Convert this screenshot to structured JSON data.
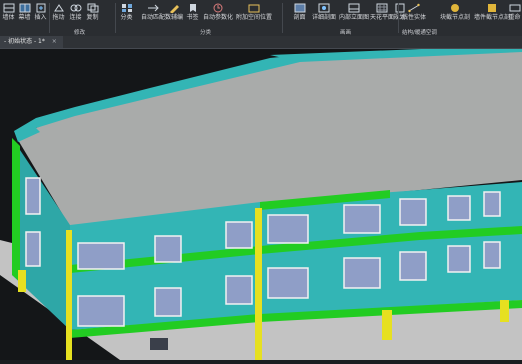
{
  "ribbon": {
    "tools": [
      {
        "id": "t1",
        "label": "墙体",
        "icon": "wall-icon"
      },
      {
        "id": "t2",
        "label": "幕墙",
        "icon": "curtain-wall-icon"
      },
      {
        "id": "t3",
        "label": "插入",
        "icon": "insert-icon"
      },
      {
        "id": "t4",
        "label": "拖动",
        "icon": "drag-icon"
      },
      {
        "id": "t5",
        "label": "连接",
        "icon": "connect-icon"
      },
      {
        "id": "t6",
        "label": "复制",
        "icon": "copy-icon"
      },
      {
        "id": "t7",
        "label": "分类",
        "icon": "classify-icon"
      },
      {
        "id": "t8",
        "label": "自动匹配",
        "icon": "auto-match-icon"
      },
      {
        "id": "t9",
        "label": "数辅编",
        "icon": "assist-edit-icon"
      },
      {
        "id": "t10",
        "label": "书签",
        "icon": "bookmark-icon"
      },
      {
        "id": "t11",
        "label": "自动参数化",
        "icon": "auto-param-icon"
      },
      {
        "id": "t12",
        "label": "附加空间位置",
        "icon": "space-position-icon"
      },
      {
        "id": "t13",
        "label": "剖面",
        "icon": "section-icon"
      },
      {
        "id": "t14",
        "label": "详细剖面",
        "icon": "detail-section-icon"
      },
      {
        "id": "t15",
        "label": "内部立面图",
        "icon": "interior-elevation-icon"
      },
      {
        "id": "t16",
        "label": "天花平面",
        "icon": "ceiling-plan-icon"
      },
      {
        "id": "t17",
        "label": "规划",
        "icon": "plan-icon"
      },
      {
        "id": "t18",
        "label": "线性实体",
        "icon": "linear-entity-icon"
      },
      {
        "id": "t19",
        "label": "块截节点剖",
        "icon": "block-section-icon"
      },
      {
        "id": "t20",
        "label": "墙件截节点剖",
        "icon": "wall-section-icon"
      },
      {
        "id": "t21",
        "label": "重命",
        "icon": "rename-icon"
      }
    ],
    "groups": [
      {
        "id": "g1",
        "label": "修改"
      },
      {
        "id": "g2",
        "label": "分类"
      },
      {
        "id": "g3",
        "label": "画画"
      },
      {
        "id": "g4",
        "label": "结构/暖通空调"
      }
    ]
  },
  "document_tab": {
    "label": "- 初始状态 - 1*",
    "close": "×"
  },
  "colors": {
    "roof": "#a9abaa",
    "wall": "#33b5b5",
    "band": "#22cc22",
    "column": "#e6e020",
    "window_glass": "#8f9ec7",
    "window_frame": "#f2f2f2",
    "ground": "#c3c3c3",
    "background": "#141618"
  }
}
